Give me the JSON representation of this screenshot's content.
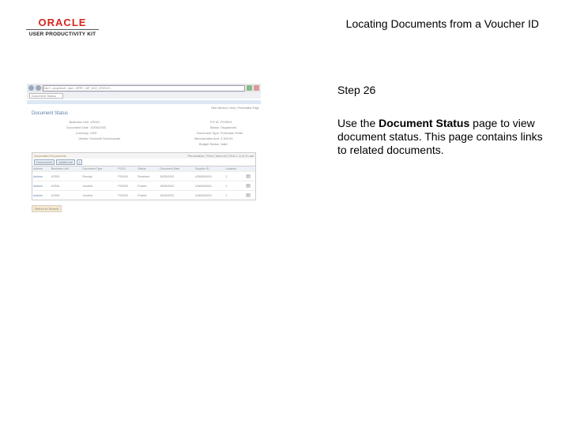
{
  "logo": {
    "brand": "ORACLE",
    "subtitle": "USER PRODUCTIVITY KIT"
  },
  "header": {
    "title": "Locating Documents from a Voucher ID"
  },
  "step": {
    "label": "Step 26",
    "desc_pre": "Use the ",
    "desc_bold": "Document Status",
    "desc_post": " page to view document status. This page contains links to related documents."
  },
  "screenshot": {
    "url": "http://...peoplesoft.../psc/.../ERP/.../AP_DOC_STATUS...",
    "tab": "Document Status",
    "links": "New Window | Help | Personalize Page",
    "page_title": "Document Status",
    "fields": [
      [
        "Business Unit",
        "US001",
        "PO ID",
        "PO0001"
      ],
      [
        "Document Date",
        "10/05/2003",
        "Status",
        "Dispatched"
      ],
      [
        "Currency",
        "USD",
        "Document Type",
        "Purchase Order"
      ],
      [
        "Vendor",
        "Kenneth Schumacher",
        "Merchandise Amt",
        "2,300.00"
      ],
      [
        "",
        "",
        "Budget Status",
        "Valid"
      ]
    ],
    "assoc_title": "Associated Documents",
    "assoc_nav": "Personalize | Find | View All | First 1-3 of 3 Last",
    "subtabs": [
      "Documents",
      "Additional",
      "|"
    ],
    "columns": [
      "Actions",
      "Business Unit",
      "Document Type",
      "PO ID",
      "Status",
      "Document Date",
      "Supplier ID",
      "Location"
    ],
    "rows": [
      [
        "Actions",
        "US001",
        "Receipt",
        "PO0001",
        "Received",
        "10/05/2003",
        "USA0000001",
        "1"
      ],
      [
        "Actions",
        "US001",
        "Voucher",
        "PO0001",
        "Posted",
        "10/05/2003",
        "USA0000001",
        "1"
      ],
      [
        "Actions",
        "US001",
        "Voucher",
        "PO0001",
        "Posted",
        "10/05/2003",
        "USA0000001",
        "1"
      ]
    ],
    "return_button": "Return to Search"
  }
}
